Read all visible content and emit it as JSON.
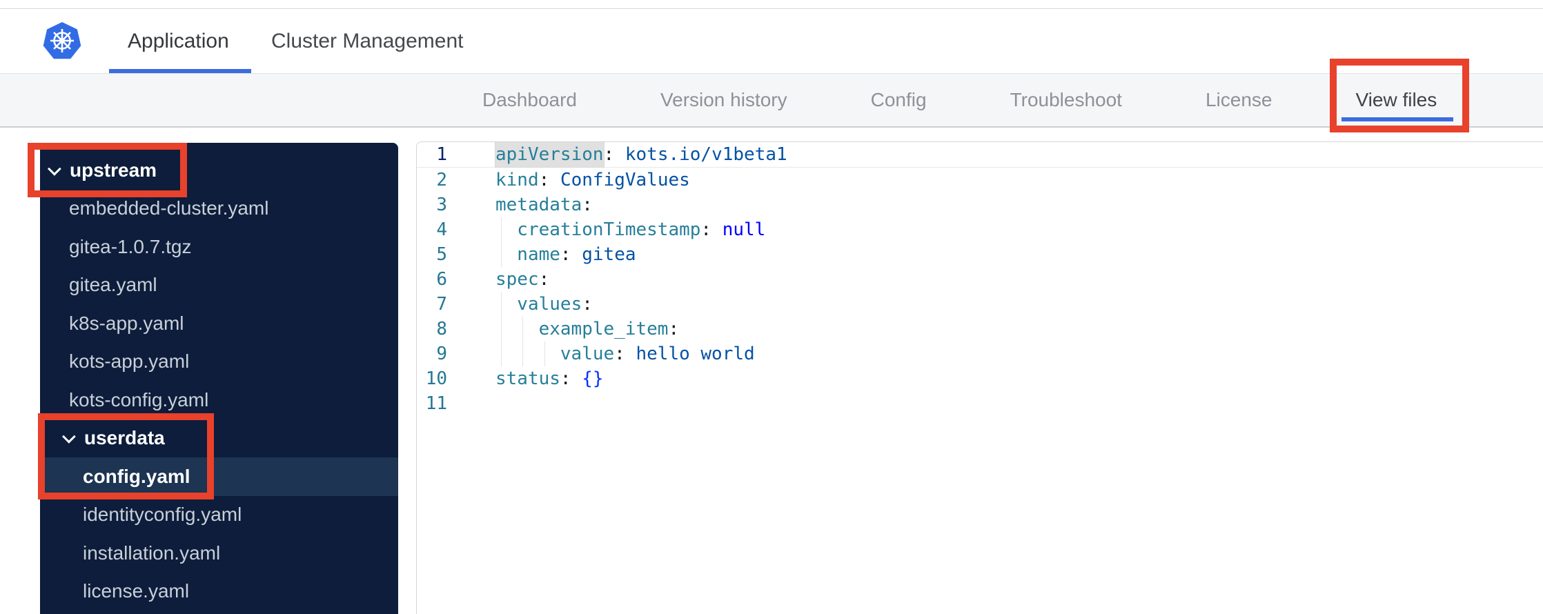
{
  "header": {
    "logo": "kubernetes-logo",
    "tabs": [
      {
        "label": "Application",
        "active": true
      },
      {
        "label": "Cluster Management",
        "active": false
      }
    ]
  },
  "subnav": {
    "items": [
      {
        "label": "Dashboard",
        "active": false
      },
      {
        "label": "Version history",
        "active": false
      },
      {
        "label": "Config",
        "active": false
      },
      {
        "label": "Troubleshoot",
        "active": false
      },
      {
        "label": "License",
        "active": false
      },
      {
        "label": "View files",
        "active": true,
        "annotated": true
      }
    ]
  },
  "file_tree": {
    "items": [
      {
        "label": "upstream",
        "type": "folder",
        "depth": 1,
        "expanded": true,
        "annotated": "upstream"
      },
      {
        "label": "embedded-cluster.yaml",
        "type": "file",
        "depth": 1
      },
      {
        "label": "gitea-1.0.7.tgz",
        "type": "file",
        "depth": 1
      },
      {
        "label": "gitea.yaml",
        "type": "file",
        "depth": 1
      },
      {
        "label": "k8s-app.yaml",
        "type": "file",
        "depth": 1
      },
      {
        "label": "kots-app.yaml",
        "type": "file",
        "depth": 1
      },
      {
        "label": "kots-config.yaml",
        "type": "file",
        "depth": 1
      },
      {
        "label": "userdata",
        "type": "folder",
        "depth": 2,
        "expanded": true,
        "annotated": "userdata"
      },
      {
        "label": "config.yaml",
        "type": "file",
        "depth": 2,
        "selected": true
      },
      {
        "label": "identityconfig.yaml",
        "type": "file",
        "depth": 2
      },
      {
        "label": "installation.yaml",
        "type": "file",
        "depth": 2
      },
      {
        "label": "license.yaml",
        "type": "file",
        "depth": 2
      }
    ]
  },
  "editor": {
    "language": "yaml",
    "active_line": 1,
    "lines": [
      {
        "n": 1,
        "indent": 0,
        "tokens": [
          {
            "c": "key",
            "t": "apiVersion",
            "hl": true
          },
          {
            "c": "punc",
            "t": ": "
          },
          {
            "c": "str",
            "t": "kots.io/v1beta1"
          }
        ]
      },
      {
        "n": 2,
        "indent": 0,
        "tokens": [
          {
            "c": "key",
            "t": "kind"
          },
          {
            "c": "punc",
            "t": ": "
          },
          {
            "c": "str",
            "t": "ConfigValues"
          }
        ]
      },
      {
        "n": 3,
        "indent": 0,
        "tokens": [
          {
            "c": "key",
            "t": "metadata"
          },
          {
            "c": "punc",
            "t": ":"
          }
        ]
      },
      {
        "n": 4,
        "indent": 2,
        "tokens": [
          {
            "c": "key",
            "t": "creationTimestamp"
          },
          {
            "c": "punc",
            "t": ": "
          },
          {
            "c": "kw",
            "t": "null"
          }
        ]
      },
      {
        "n": 5,
        "indent": 2,
        "tokens": [
          {
            "c": "key",
            "t": "name"
          },
          {
            "c": "punc",
            "t": ": "
          },
          {
            "c": "str",
            "t": "gitea"
          }
        ]
      },
      {
        "n": 6,
        "indent": 0,
        "tokens": [
          {
            "c": "key",
            "t": "spec"
          },
          {
            "c": "punc",
            "t": ":"
          }
        ]
      },
      {
        "n": 7,
        "indent": 2,
        "tokens": [
          {
            "c": "key",
            "t": "values"
          },
          {
            "c": "punc",
            "t": ":"
          }
        ]
      },
      {
        "n": 8,
        "indent": 4,
        "tokens": [
          {
            "c": "key",
            "t": "example_item"
          },
          {
            "c": "punc",
            "t": ":"
          }
        ]
      },
      {
        "n": 9,
        "indent": 6,
        "tokens": [
          {
            "c": "key",
            "t": "value"
          },
          {
            "c": "punc",
            "t": ": "
          },
          {
            "c": "str",
            "t": "hello world"
          }
        ]
      },
      {
        "n": 10,
        "indent": 0,
        "tokens": [
          {
            "c": "key",
            "t": "status"
          },
          {
            "c": "punc",
            "t": ": "
          },
          {
            "c": "br",
            "t": "{}"
          }
        ]
      },
      {
        "n": 11,
        "indent": 0,
        "tokens": []
      }
    ]
  },
  "colors": {
    "accent_blue": "#3b6ce0",
    "k8s_blue": "#326ce5",
    "annotation_red": "#e8412c",
    "sidebar_bg": "#0d1d3b",
    "sidebar_selected_bg": "#1d3452",
    "syntax_key": "#267f99",
    "syntax_string": "#0451a5",
    "syntax_keyword": "#0000ff",
    "line_number": "#237893",
    "line_number_active": "#0b216f"
  }
}
